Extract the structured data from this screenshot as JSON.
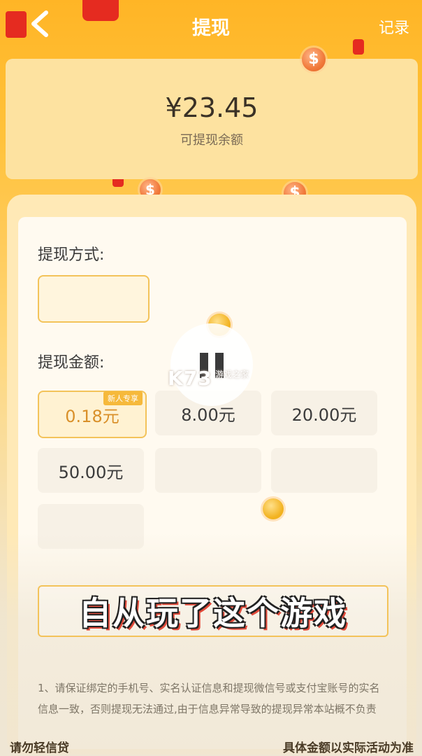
{
  "header": {
    "title": "提现",
    "records_label": "记录"
  },
  "balance": {
    "amount": "¥23.45",
    "label": "可提现余额"
  },
  "withdraw_method": {
    "label": "提现方式:"
  },
  "withdraw_amount": {
    "label": "提现金额:",
    "options": [
      {
        "value": "0.18元",
        "tag": "新人专享",
        "selected": true
      },
      {
        "value": "8.00元"
      },
      {
        "value": "20.00元"
      },
      {
        "value": "50.00元"
      }
    ]
  },
  "watermark": {
    "brand": "K73",
    "sub1": "游戏之家"
  },
  "subtitle": "自从玩了这个游戏",
  "note": "1、请保证绑定的手机号、实名认证信息和提现微信号或支付宝账号的实名信息一致，否则提现无法通过,由于信息异常导致的提现异常本站概不负责",
  "bottom": {
    "left": "请勿轻信贷",
    "right": "具体金额以实际活动为准"
  },
  "colors": {
    "accent": "#ffb526",
    "selected_border": "#f3c35a",
    "coin": "#f17a3b"
  }
}
